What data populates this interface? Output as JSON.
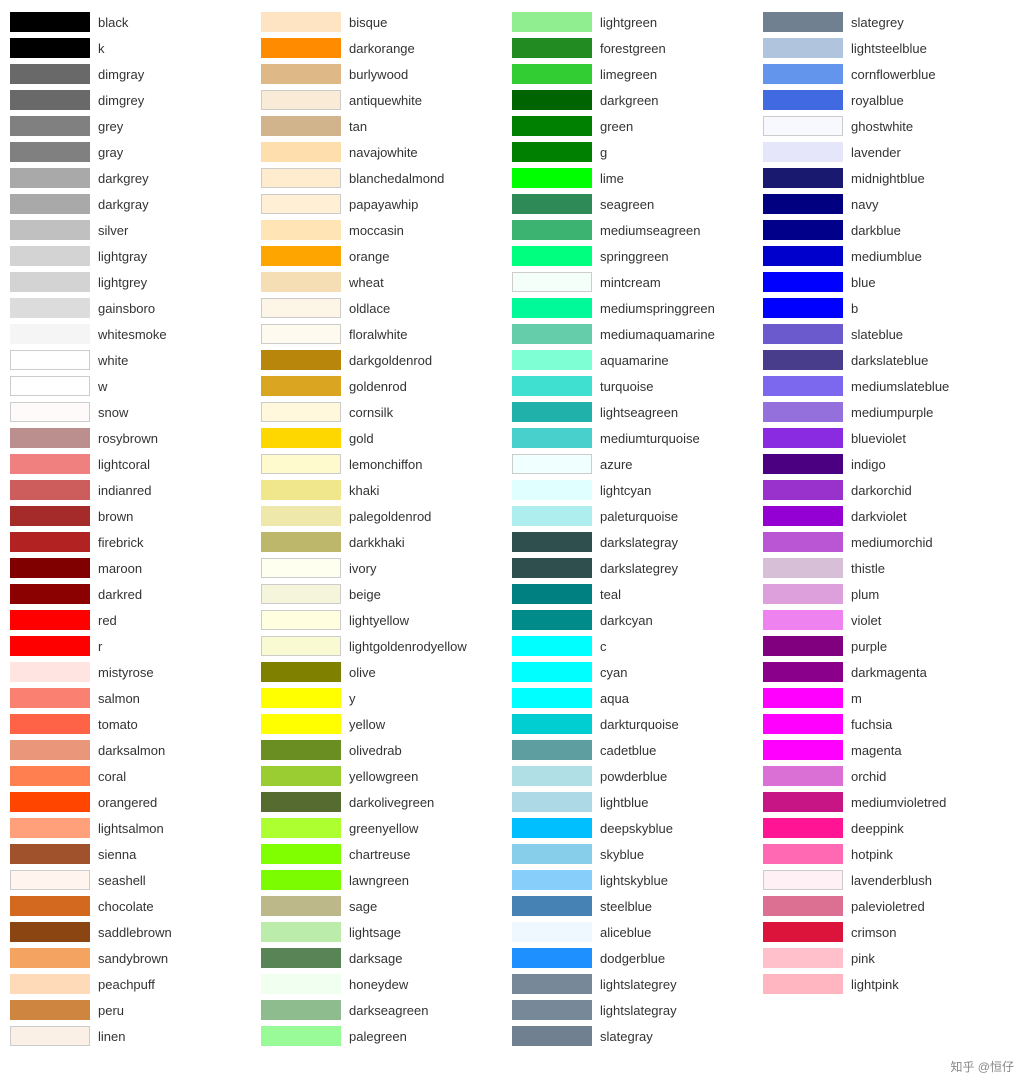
{
  "columns": [
    {
      "id": "col1",
      "items": [
        {
          "name": "black",
          "color": "#000000"
        },
        {
          "name": "k",
          "color": "#000000"
        },
        {
          "name": "dimgray",
          "color": "#696969"
        },
        {
          "name": "dimgrey",
          "color": "#696969"
        },
        {
          "name": "grey",
          "color": "#808080"
        },
        {
          "name": "gray",
          "color": "#808080"
        },
        {
          "name": "darkgrey",
          "color": "#a9a9a9"
        },
        {
          "name": "darkgray",
          "color": "#a9a9a9"
        },
        {
          "name": "silver",
          "color": "#c0c0c0"
        },
        {
          "name": "lightgray",
          "color": "#d3d3d3"
        },
        {
          "name": "lightgrey",
          "color": "#d3d3d3"
        },
        {
          "name": "gainsboro",
          "color": "#dcdcdc"
        },
        {
          "name": "whitesmoke",
          "color": "#f5f5f5"
        },
        {
          "name": "white",
          "color": "#ffffff"
        },
        {
          "name": "w",
          "color": "#ffffff"
        },
        {
          "name": "snow",
          "color": "#fffafa"
        },
        {
          "name": "rosybrown",
          "color": "#bc8f8f"
        },
        {
          "name": "lightcoral",
          "color": "#f08080"
        },
        {
          "name": "indianred",
          "color": "#cd5c5c"
        },
        {
          "name": "brown",
          "color": "#a52a2a"
        },
        {
          "name": "firebrick",
          "color": "#b22222"
        },
        {
          "name": "maroon",
          "color": "#800000"
        },
        {
          "name": "darkred",
          "color": "#8b0000"
        },
        {
          "name": "red",
          "color": "#ff0000"
        },
        {
          "name": "r",
          "color": "#ff0000"
        },
        {
          "name": "mistyrose",
          "color": "#ffe4e1"
        },
        {
          "name": "salmon",
          "color": "#fa8072"
        },
        {
          "name": "tomato",
          "color": "#ff6347"
        },
        {
          "name": "darksalmon",
          "color": "#e9967a"
        },
        {
          "name": "coral",
          "color": "#ff7f50"
        },
        {
          "name": "orangered",
          "color": "#ff4500"
        },
        {
          "name": "lightsalmon",
          "color": "#ffa07a"
        },
        {
          "name": "sienna",
          "color": "#a0522d"
        },
        {
          "name": "seashell",
          "color": "#fff5ee"
        },
        {
          "name": "chocolate",
          "color": "#d2691e"
        },
        {
          "name": "saddlebrown",
          "color": "#8b4513"
        },
        {
          "name": "sandybrown",
          "color": "#f4a460"
        },
        {
          "name": "peachpuff",
          "color": "#ffdab9"
        },
        {
          "name": "peru",
          "color": "#cd853f"
        },
        {
          "name": "linen",
          "color": "#faf0e6"
        }
      ]
    },
    {
      "id": "col2",
      "items": [
        {
          "name": "bisque",
          "color": "#ffe4c4"
        },
        {
          "name": "darkorange",
          "color": "#ff8c00"
        },
        {
          "name": "burlywood",
          "color": "#deb887"
        },
        {
          "name": "antiquewhite",
          "color": "#faebd7"
        },
        {
          "name": "tan",
          "color": "#d2b48c"
        },
        {
          "name": "navajowhite",
          "color": "#ffdead"
        },
        {
          "name": "blanchedalmond",
          "color": "#ffebcd"
        },
        {
          "name": "papayawhip",
          "color": "#ffefd5"
        },
        {
          "name": "moccasin",
          "color": "#ffe4b5"
        },
        {
          "name": "orange",
          "color": "#ffa500"
        },
        {
          "name": "wheat",
          "color": "#f5deb3"
        },
        {
          "name": "oldlace",
          "color": "#fdf5e6"
        },
        {
          "name": "floralwhite",
          "color": "#fffaf0"
        },
        {
          "name": "darkgoldenrod",
          "color": "#b8860b"
        },
        {
          "name": "goldenrod",
          "color": "#daa520"
        },
        {
          "name": "cornsilk",
          "color": "#fff8dc"
        },
        {
          "name": "gold",
          "color": "#ffd700"
        },
        {
          "name": "lemonchiffon",
          "color": "#fffacd"
        },
        {
          "name": "khaki",
          "color": "#f0e68c"
        },
        {
          "name": "palegoldenrod",
          "color": "#eee8aa"
        },
        {
          "name": "darkkhaki",
          "color": "#bdb76b"
        },
        {
          "name": "ivory",
          "color": "#fffff0"
        },
        {
          "name": "beige",
          "color": "#f5f5dc"
        },
        {
          "name": "lightyellow",
          "color": "#ffffe0"
        },
        {
          "name": "lightgoldenrodyellow",
          "color": "#fafad2"
        },
        {
          "name": "olive",
          "color": "#808000"
        },
        {
          "name": "y",
          "color": "#ffff00"
        },
        {
          "name": "yellow",
          "color": "#ffff00"
        },
        {
          "name": "olivedrab",
          "color": "#6b8e23"
        },
        {
          "name": "yellowgreen",
          "color": "#9acd32"
        },
        {
          "name": "darkolivegreen",
          "color": "#556b2f"
        },
        {
          "name": "greenyellow",
          "color": "#adff2f"
        },
        {
          "name": "chartreuse",
          "color": "#7fff00"
        },
        {
          "name": "lawngreen",
          "color": "#7cfc00"
        },
        {
          "name": "sage",
          "color": "#bcb88a"
        },
        {
          "name": "lightsage",
          "color": "#bcecac"
        },
        {
          "name": "darksage",
          "color": "#598556"
        },
        {
          "name": "honeydew",
          "color": "#f0fff0"
        },
        {
          "name": "darkseagreen",
          "color": "#8fbc8f"
        },
        {
          "name": "palegreen",
          "color": "#98fb98"
        }
      ]
    },
    {
      "id": "col3",
      "items": [
        {
          "name": "lightgreen",
          "color": "#90ee90"
        },
        {
          "name": "forestgreen",
          "color": "#228b22"
        },
        {
          "name": "limegreen",
          "color": "#32cd32"
        },
        {
          "name": "darkgreen",
          "color": "#006400"
        },
        {
          "name": "green",
          "color": "#008000"
        },
        {
          "name": "g",
          "color": "#008000"
        },
        {
          "name": "lime",
          "color": "#00ff00"
        },
        {
          "name": "seagreen",
          "color": "#2e8b57"
        },
        {
          "name": "mediumseagreen",
          "color": "#3cb371"
        },
        {
          "name": "springgreen",
          "color": "#00ff7f"
        },
        {
          "name": "mintcream",
          "color": "#f5fffa"
        },
        {
          "name": "mediumspringgreen",
          "color": "#00fa9a"
        },
        {
          "name": "mediumaquamarine",
          "color": "#66cdaa"
        },
        {
          "name": "aquamarine",
          "color": "#7fffd4"
        },
        {
          "name": "turquoise",
          "color": "#40e0d0"
        },
        {
          "name": "lightseagreen",
          "color": "#20b2aa"
        },
        {
          "name": "mediumturquoise",
          "color": "#48d1cc"
        },
        {
          "name": "azure",
          "color": "#f0ffff"
        },
        {
          "name": "lightcyan",
          "color": "#e0ffff"
        },
        {
          "name": "paleturquoise",
          "color": "#afeeee"
        },
        {
          "name": "darkslategray",
          "color": "#2f4f4f"
        },
        {
          "name": "darkslategrey",
          "color": "#2f4f4f"
        },
        {
          "name": "teal",
          "color": "#008080"
        },
        {
          "name": "darkcyan",
          "color": "#008b8b"
        },
        {
          "name": "c",
          "color": "#00ffff"
        },
        {
          "name": "cyan",
          "color": "#00ffff"
        },
        {
          "name": "aqua",
          "color": "#00ffff"
        },
        {
          "name": "darkturquoise",
          "color": "#00ced1"
        },
        {
          "name": "cadetblue",
          "color": "#5f9ea0"
        },
        {
          "name": "powderblue",
          "color": "#b0e0e6"
        },
        {
          "name": "lightblue",
          "color": "#add8e6"
        },
        {
          "name": "deepskyblue",
          "color": "#00bfff"
        },
        {
          "name": "skyblue",
          "color": "#87ceeb"
        },
        {
          "name": "lightskyblue",
          "color": "#87cefa"
        },
        {
          "name": "steelblue",
          "color": "#4682b4"
        },
        {
          "name": "aliceblue",
          "color": "#f0f8ff"
        },
        {
          "name": "dodgerblue",
          "color": "#1e90ff"
        },
        {
          "name": "lightslategrey",
          "color": "#778899"
        },
        {
          "name": "lightslategray",
          "color": "#778899"
        },
        {
          "name": "slategray",
          "color": "#708090"
        }
      ]
    },
    {
      "id": "col4",
      "items": [
        {
          "name": "slategrey",
          "color": "#708090"
        },
        {
          "name": "lightsteelblue",
          "color": "#b0c4de"
        },
        {
          "name": "cornflowerblue",
          "color": "#6495ed"
        },
        {
          "name": "royalblue",
          "color": "#4169e1"
        },
        {
          "name": "ghostwhite",
          "color": "#f8f8ff"
        },
        {
          "name": "lavender",
          "color": "#e6e6fa"
        },
        {
          "name": "midnightblue",
          "color": "#191970"
        },
        {
          "name": "navy",
          "color": "#000080"
        },
        {
          "name": "darkblue",
          "color": "#00008b"
        },
        {
          "name": "mediumblue",
          "color": "#0000cd"
        },
        {
          "name": "blue",
          "color": "#0000ff"
        },
        {
          "name": "b",
          "color": "#0000ff"
        },
        {
          "name": "slateblue",
          "color": "#6a5acd"
        },
        {
          "name": "darkslateblue",
          "color": "#483d8b"
        },
        {
          "name": "mediumslateblue",
          "color": "#7b68ee"
        },
        {
          "name": "mediumpurple",
          "color": "#9370db"
        },
        {
          "name": "blueviolet",
          "color": "#8a2be2"
        },
        {
          "name": "indigo",
          "color": "#4b0082"
        },
        {
          "name": "darkorchid",
          "color": "#9932cc"
        },
        {
          "name": "darkviolet",
          "color": "#9400d3"
        },
        {
          "name": "mediumorchid",
          "color": "#ba55d3"
        },
        {
          "name": "thistle",
          "color": "#d8bfd8"
        },
        {
          "name": "plum",
          "color": "#dda0dd"
        },
        {
          "name": "violet",
          "color": "#ee82ee"
        },
        {
          "name": "purple",
          "color": "#800080"
        },
        {
          "name": "darkmagenta",
          "color": "#8b008b"
        },
        {
          "name": "m",
          "color": "#ff00ff"
        },
        {
          "name": "fuchsia",
          "color": "#ff00ff"
        },
        {
          "name": "magenta",
          "color": "#ff00ff"
        },
        {
          "name": "orchid",
          "color": "#da70d6"
        },
        {
          "name": "mediumvioletred",
          "color": "#c71585"
        },
        {
          "name": "deeppink",
          "color": "#ff1493"
        },
        {
          "name": "hotpink",
          "color": "#ff69b4"
        },
        {
          "name": "lavenderblush",
          "color": "#fff0f5"
        },
        {
          "name": "palevioletred",
          "color": "#db7093"
        },
        {
          "name": "crimson",
          "color": "#dc143c"
        },
        {
          "name": "pink",
          "color": "#ffc0cb"
        },
        {
          "name": "lightpink",
          "color": "#ffb6c1"
        }
      ]
    }
  ],
  "watermark": "知乎 @恒仔"
}
